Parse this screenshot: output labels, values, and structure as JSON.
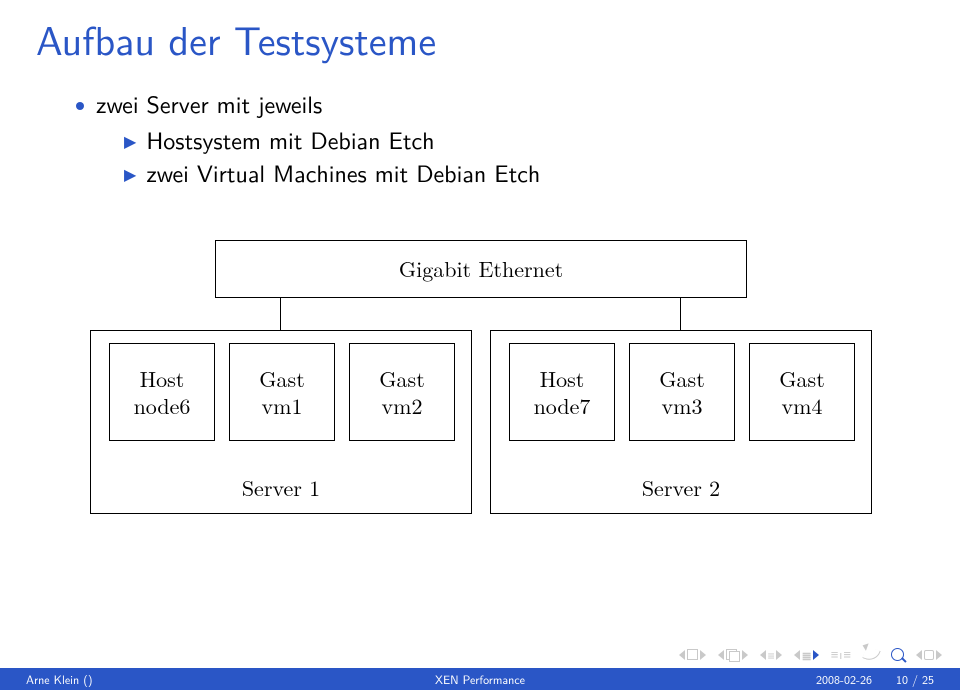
{
  "title": "Aufbau der Testsysteme",
  "bullets": {
    "main": "zwei Server mit jeweils",
    "sub1": "Hostsystem mit Debian Etch",
    "sub2": "zwei Virtual Machines mit Debian Etch"
  },
  "diagram": {
    "bus": "Gigabit Ethernet",
    "server1": {
      "label": "Server 1",
      "nodes": [
        {
          "l1": "Host",
          "l2": "node6"
        },
        {
          "l1": "Gast",
          "l2": "vm1"
        },
        {
          "l1": "Gast",
          "l2": "vm2"
        }
      ]
    },
    "server2": {
      "label": "Server 2",
      "nodes": [
        {
          "l1": "Host",
          "l2": "node7"
        },
        {
          "l1": "Gast",
          "l2": "vm3"
        },
        {
          "l1": "Gast",
          "l2": "vm4"
        }
      ]
    }
  },
  "footer": {
    "author": "Arne Klein ()",
    "title": "XEN Performance",
    "date": "2008-02-26",
    "page": "10 / 25"
  }
}
